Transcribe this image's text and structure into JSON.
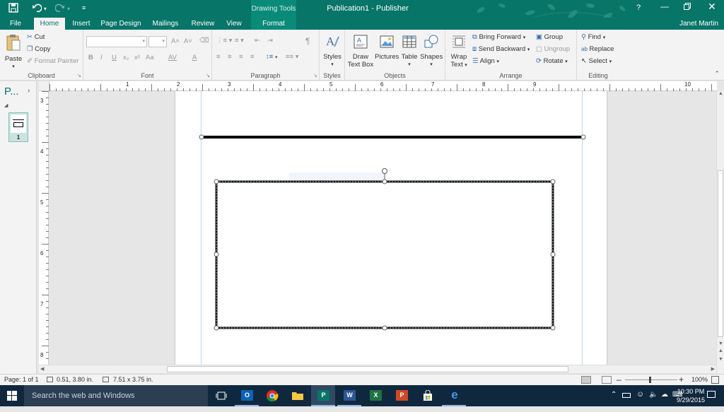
{
  "window": {
    "title": "Publication1 - Publisher",
    "context_title": "Drawing Tools",
    "help": "?",
    "user": "Janet Martin"
  },
  "tabs": [
    {
      "label": "File"
    },
    {
      "label": "Home"
    },
    {
      "label": "Insert"
    },
    {
      "label": "Page Design"
    },
    {
      "label": "Mailings"
    },
    {
      "label": "Review"
    },
    {
      "label": "View"
    },
    {
      "label": "Format"
    }
  ],
  "ribbon": {
    "clipboard": {
      "paste": "Paste",
      "cut": "Cut",
      "copy": "Copy",
      "format_painter": "Format Painter",
      "label": "Clipboard"
    },
    "font": {
      "label": "Font",
      "bold": "B",
      "italic": "I",
      "underline": "U",
      "subscript": "x₂",
      "superscript": "x²",
      "change_case": "Aa",
      "font_color": "A",
      "char_spacing": "AV",
      "grow": "A˄",
      "shrink": "A˅"
    },
    "paragraph": {
      "label": "Paragraph",
      "pilcrow": "¶"
    },
    "styles": {
      "styles": "Styles",
      "label": "Styles"
    },
    "objects": {
      "draw_text_box_1": "Draw",
      "draw_text_box_2": "Text Box",
      "pictures": "Pictures",
      "table": "Table",
      "shapes": "Shapes",
      "label": "Objects"
    },
    "arrange": {
      "wrap_text_1": "Wrap",
      "wrap_text_2": "Text",
      "bring_forward": "Bring Forward",
      "send_backward": "Send Backward",
      "align": "Align",
      "group": "Group",
      "ungroup": "Ungroup",
      "rotate": "Rotate",
      "label": "Arrange"
    },
    "editing": {
      "find": "Find",
      "replace": "Replace",
      "select": "Select",
      "label": "Editing"
    }
  },
  "navpane": {
    "title": "P...",
    "page_number": "1"
  },
  "hruler": {
    "labels": [
      "1",
      "2",
      "3",
      "4",
      "5",
      "6",
      "7",
      "8",
      "9",
      "10"
    ]
  },
  "vruler": {
    "labels": [
      "3",
      "4",
      "5",
      "6",
      "7",
      "8"
    ]
  },
  "status": {
    "page": "Page: 1 of 1",
    "position": "0.51, 3.80 in.",
    "size": "7.51 x 3.75 in.",
    "zoom": "100%"
  },
  "taskbar": {
    "search_placeholder": "Search the web and Windows",
    "time": "10:30 PM",
    "date": "9/29/2015"
  },
  "colors": {
    "accent": "#077568",
    "taskbar": "#10283e"
  }
}
